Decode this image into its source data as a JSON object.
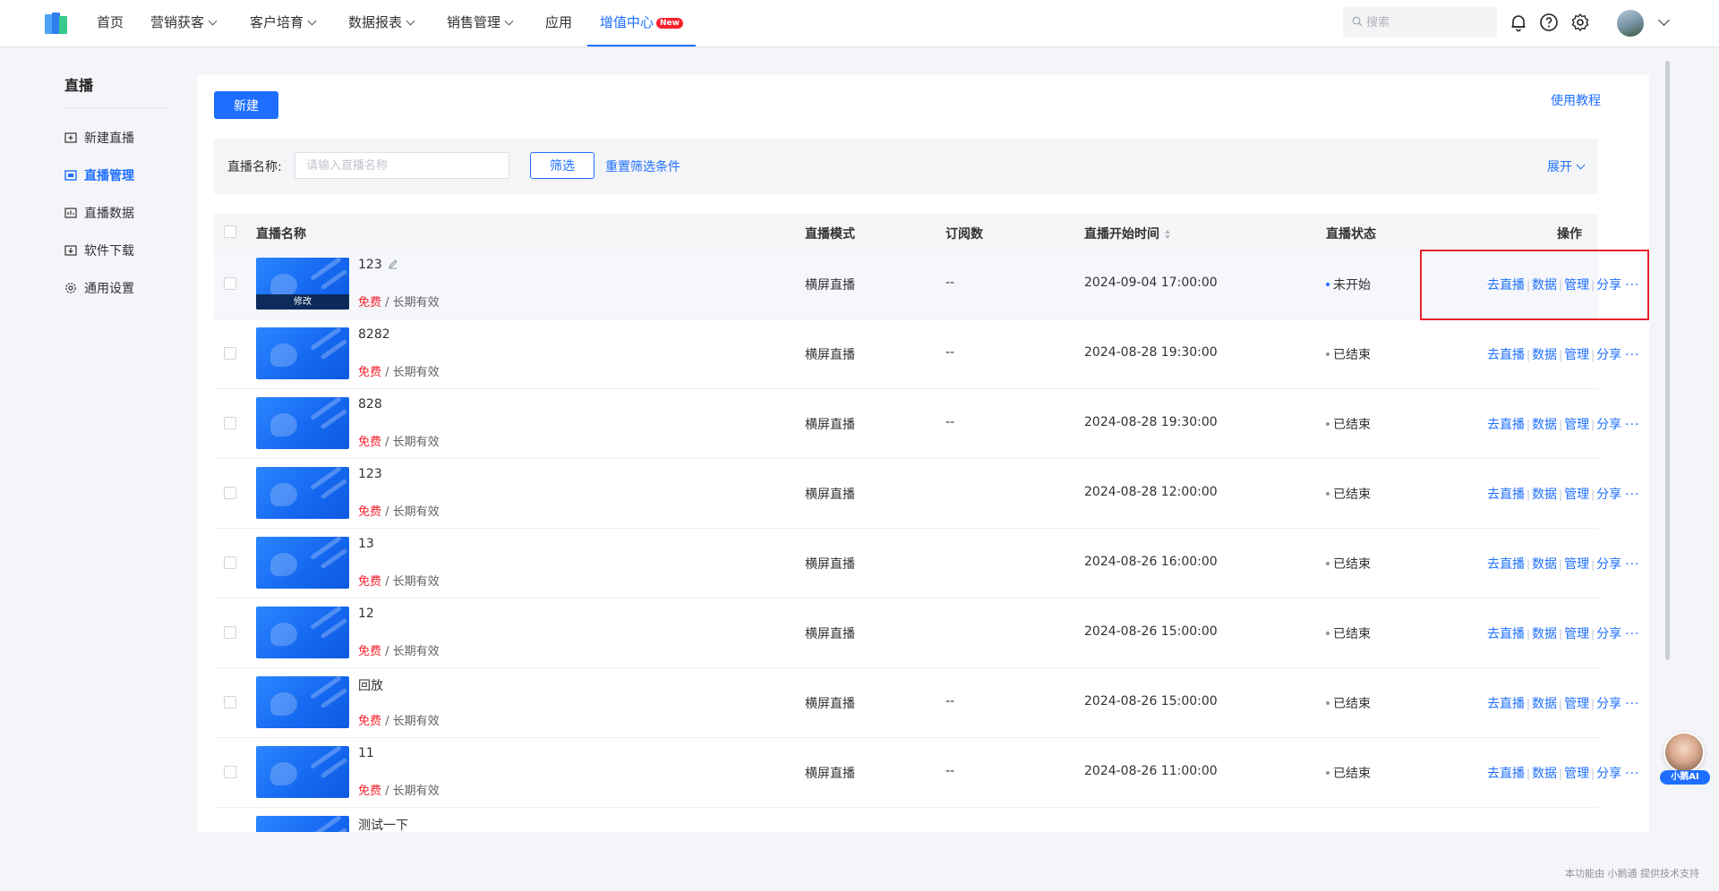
{
  "nav": {
    "items": [
      "首页",
      "营销获客",
      "客户培育",
      "数据报表",
      "销售管理",
      "应用",
      "增值中心"
    ],
    "new_badge": "New",
    "search_placeholder": "搜索"
  },
  "sidebar": {
    "title": "直播",
    "items": [
      "新建直播",
      "直播管理",
      "直播数据",
      "软件下载",
      "通用设置"
    ]
  },
  "toolbar": {
    "new_label": "新建",
    "tutorial_label": "使用教程"
  },
  "filter": {
    "label": "直播名称:",
    "placeholder": "请输入直播名称",
    "filter_label": "筛选",
    "reset_label": "重置筛选条件",
    "expand_label": "展开"
  },
  "table": {
    "headers": [
      "直播名称",
      "直播模式",
      "订阅数",
      "直播开始时间",
      "直播状态",
      "操作"
    ],
    "thumb_edit_label": "修改",
    "price_free": "免费",
    "price_sep": " / ",
    "price_valid": "长期有效",
    "actions": [
      "去直播",
      "数据",
      "管理",
      "分享",
      "···"
    ],
    "rows": [
      {
        "name": "123",
        "mode": "横屏直播",
        "subs": "--",
        "start": "2024-09-04 17:00:00",
        "status": "未开始"
      },
      {
        "name": "8282",
        "mode": "横屏直播",
        "subs": "--",
        "start": "2024-08-28 19:30:00",
        "status": "已结束"
      },
      {
        "name": "828",
        "mode": "横屏直播",
        "subs": "--",
        "start": "2024-08-28 19:30:00",
        "status": "已结束"
      },
      {
        "name": "123",
        "mode": "横屏直播",
        "subs": "",
        "start": "2024-08-28 12:00:00",
        "status": "已结束"
      },
      {
        "name": "13",
        "mode": "横屏直播",
        "subs": "",
        "start": "2024-08-26 16:00:00",
        "status": "已结束"
      },
      {
        "name": "12",
        "mode": "横屏直播",
        "subs": "",
        "start": "2024-08-26 15:00:00",
        "status": "已结束"
      },
      {
        "name": "回放",
        "mode": "横屏直播",
        "subs": "--",
        "start": "2024-08-26 15:00:00",
        "status": "已结束"
      },
      {
        "name": "11",
        "mode": "横屏直播",
        "subs": "--",
        "start": "2024-08-26 11:00:00",
        "status": "已结束"
      },
      {
        "name": "测试一下",
        "mode": "",
        "subs": "",
        "start": "",
        "status": ""
      }
    ]
  },
  "assistant": {
    "label": "小鹅AI"
  },
  "footer": {
    "note": "本功能由 小鹅通 提供技术支持"
  },
  "colors": {
    "accent": "#1e6fff",
    "free_price": "#f5222d",
    "highlight_box": "#e8202e"
  }
}
